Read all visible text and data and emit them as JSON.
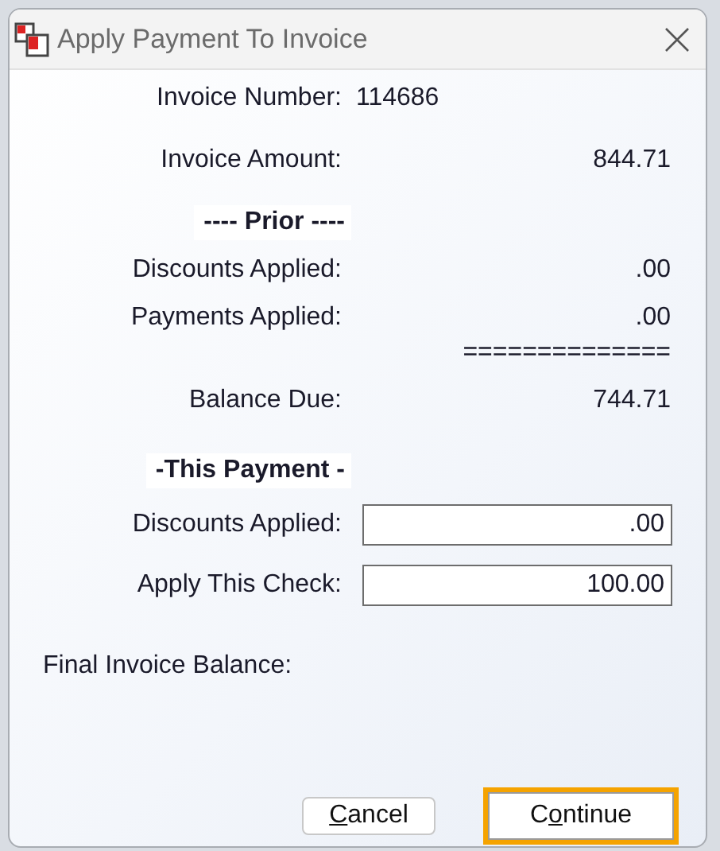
{
  "window": {
    "title": "Apply Payment To Invoice"
  },
  "rows": [
    {
      "kind": "inline",
      "label": "Invoice Number:",
      "value": "114686"
    },
    {
      "kind": "value",
      "label": "Invoice Amount:",
      "value": "844.71"
    },
    {
      "kind": "heading",
      "label": "---- Prior ----"
    },
    {
      "kind": "value",
      "label": "Discounts Applied:",
      "value": ".00"
    },
    {
      "kind": "value",
      "label": "Payments Applied:",
      "value": ".00"
    },
    {
      "kind": "rule",
      "value": "=============="
    },
    {
      "kind": "total",
      "label": "Balance Due:",
      "value": "744.71"
    },
    {
      "kind": "heading",
      "label": "-This Payment -"
    },
    {
      "kind": "field",
      "label": "Discounts Applied:",
      "value": ".00"
    },
    {
      "kind": "field",
      "label": "Apply This Check:",
      "value": "100.00"
    },
    {
      "kind": "summary",
      "label": "Final Invoice Balance:"
    }
  ],
  "buttons": [
    {
      "label_parts": [
        {
          "text": "C",
          "underlined": true
        },
        {
          "text": "ancel",
          "underlined": false
        }
      ],
      "highlighted": false
    },
    {
      "label_parts": [
        {
          "text": "C",
          "underlined": false
        },
        {
          "text": "o",
          "underlined": true
        },
        {
          "text": "ntinue",
          "underlined": false
        }
      ],
      "highlighted": true
    }
  ]
}
